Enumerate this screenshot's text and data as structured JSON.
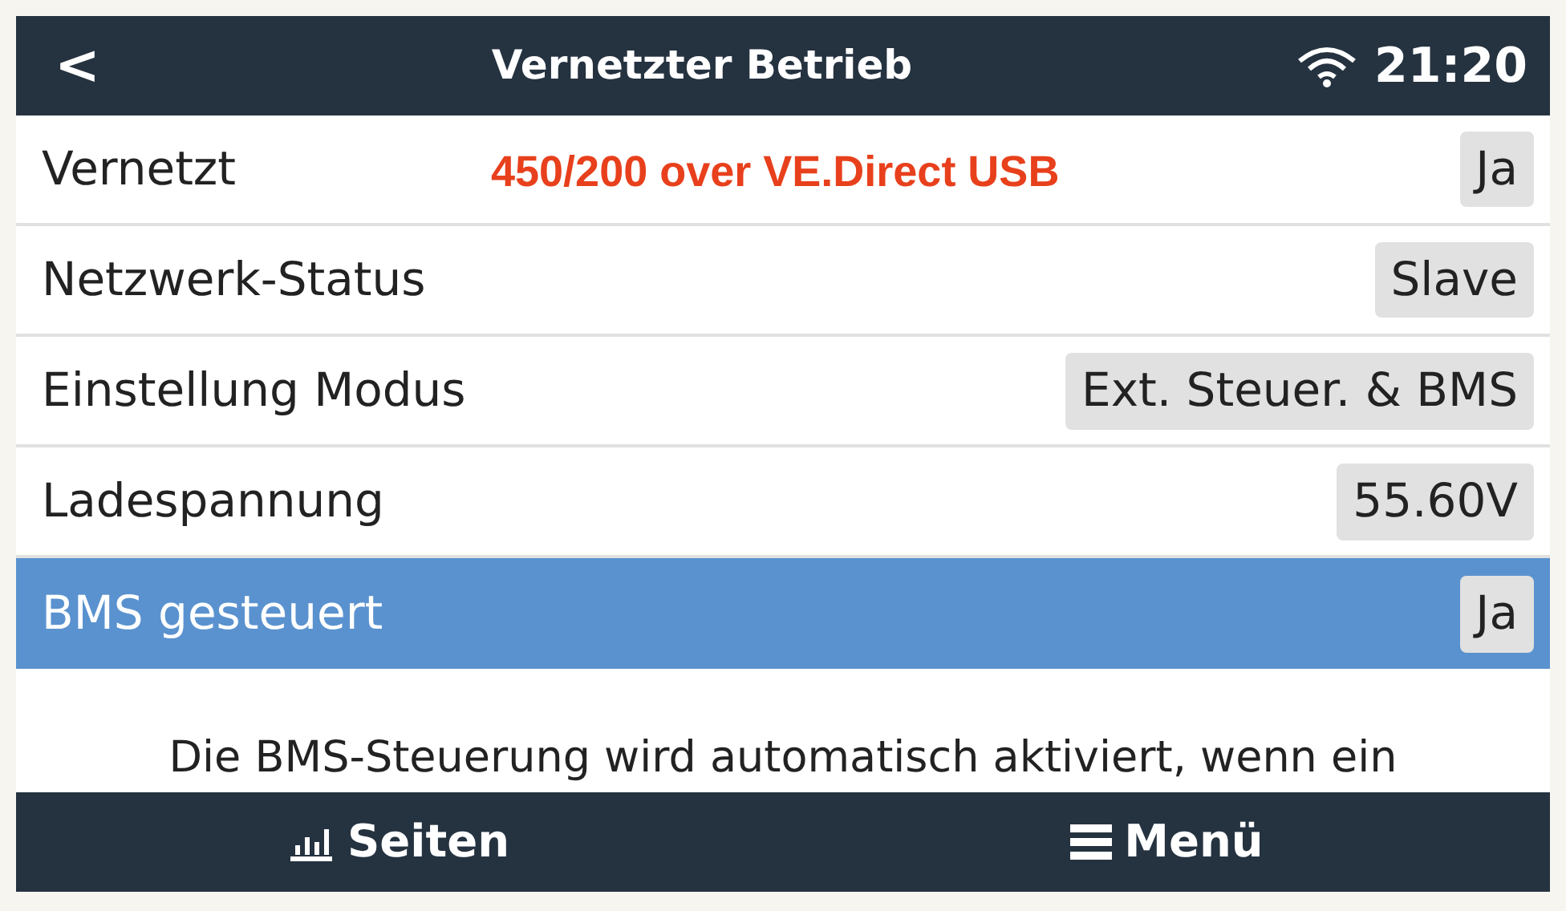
{
  "header": {
    "back": "<",
    "title": "Vernetzter Betrieb",
    "time": "21:20"
  },
  "annotation": "450/200 over VE.Direct USB",
  "rows": [
    {
      "label": "Vernetzt",
      "value": "Ja",
      "selected": false
    },
    {
      "label": "Netzwerk-Status",
      "value": "Slave",
      "selected": false
    },
    {
      "label": "Einstellung Modus",
      "value": "Ext. Steuer. & BMS",
      "selected": false
    },
    {
      "label": "Ladespannung",
      "value": "55.60V",
      "selected": false
    },
    {
      "label": "BMS gesteuert",
      "value": "Ja",
      "selected": true
    }
  ],
  "description": "Die BMS-Steuerung wird automatisch aktiviert, wenn ein",
  "footer": {
    "pages": "Seiten",
    "menu": "Menü"
  }
}
